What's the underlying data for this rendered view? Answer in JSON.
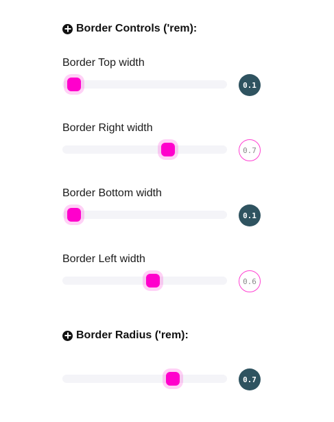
{
  "border_controls": {
    "title": "Border Controls ('rem):",
    "icon": "plus-circle-icon",
    "sliders": [
      {
        "label": "Border Top width",
        "value": "0.1",
        "badge_style": "dark",
        "fraction": 0.07
      },
      {
        "label": "Border Right width",
        "value": "0.7",
        "badge_style": "light",
        "fraction": 0.64
      },
      {
        "label": "Border Bottom width",
        "value": "0.1",
        "badge_style": "dark",
        "fraction": 0.07
      },
      {
        "label": "Border Left width",
        "value": "0.6",
        "badge_style": "light",
        "fraction": 0.55
      }
    ]
  },
  "border_radius": {
    "title": "Border Radius ('rem):",
    "icon": "plus-circle-icon",
    "slider": {
      "value": "0.7",
      "badge_style": "dark",
      "fraction": 0.67
    }
  },
  "colors": {
    "accent": "#ff00cc",
    "badge_dark": "#2f5360",
    "track": "#f4f4f8"
  }
}
